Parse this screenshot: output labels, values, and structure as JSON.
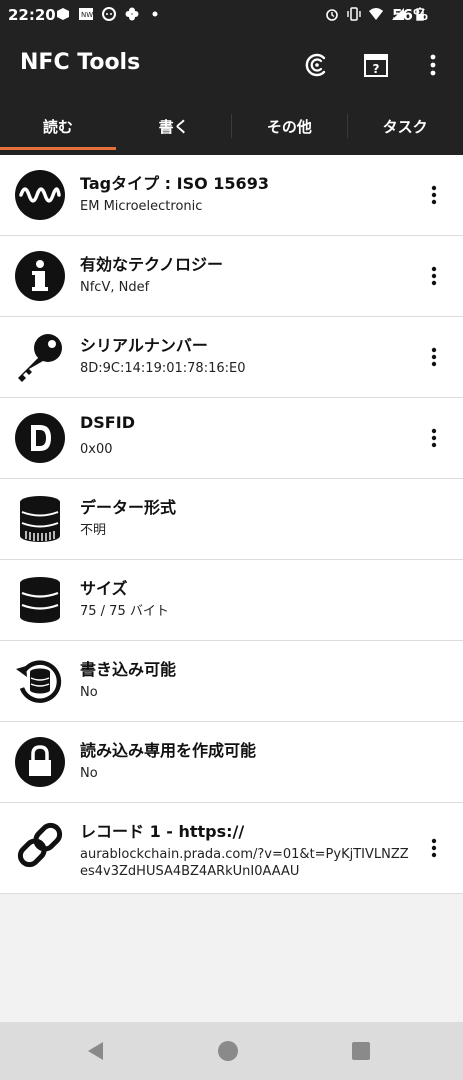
{
  "status_bar": {
    "time": "22:20",
    "battery": "56%",
    "notification_icons": [
      "package-icon",
      "nw-app-icon",
      "cat-app-icon",
      "fan-app-icon",
      "dot-icon"
    ],
    "system_icons": [
      "alarm-icon",
      "vibrate-icon",
      "wifi-icon",
      "signal-icon",
      "battery-icon"
    ]
  },
  "app_bar": {
    "title": "NFC Tools",
    "actions": [
      "nfc-scan-icon",
      "help-icon",
      "more-vert-icon"
    ]
  },
  "tabs": [
    {
      "label": "読む",
      "active": true
    },
    {
      "label": "書く",
      "active": false
    },
    {
      "label": "その他",
      "active": false
    },
    {
      "label": "タスク",
      "active": false
    }
  ],
  "accent_color": "#e8703a",
  "items": [
    {
      "title": "Tagタイプ : ISO 15693",
      "value": "EM Microelectronic",
      "icon": "signal-wave-icon",
      "has_menu": true
    },
    {
      "title": "有効なテクノロジー",
      "value": "NfcV, Ndef",
      "icon": "info-icon",
      "has_menu": true
    },
    {
      "title": "シリアルナンバー",
      "value": "8D:9C:14:19:01:78:16:E0",
      "icon": "key-icon",
      "has_menu": true
    },
    {
      "title": "DSFID",
      "value": "0x00",
      "icon": "letter-d-icon",
      "has_menu": true
    },
    {
      "title": "データー形式",
      "value": "不明",
      "icon": "database-icon",
      "has_menu": false
    },
    {
      "title": "サイズ",
      "value": "75 / 75 バイト",
      "icon": "database-stack-icon",
      "has_menu": false
    },
    {
      "title": "書き込み可能",
      "value": "No",
      "icon": "database-sync-icon",
      "has_menu": false
    },
    {
      "title": "読み込み専用を作成可能",
      "value": "No",
      "icon": "lock-icon",
      "has_menu": false
    },
    {
      "title": "レコード 1 - https://",
      "value": "aurablockchain.prada.com/?v=01&t=PyKjTIVLNZZes4v3ZdHUSA4BZ4ARkUnI0AAAU",
      "icon": "link-icon",
      "has_menu": true
    }
  ],
  "nav_bar": [
    "back-icon",
    "home-icon",
    "recents-icon"
  ]
}
